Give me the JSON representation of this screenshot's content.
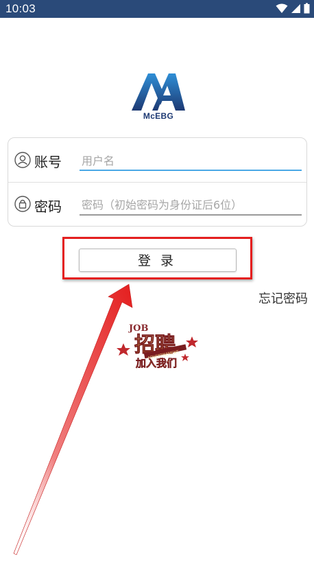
{
  "status_bar": {
    "time": "10:03",
    "background": "#2a4a79",
    "icons": [
      "wifi-icon",
      "cellular-signal-icon",
      "battery-icon"
    ]
  },
  "logo": {
    "text": "McEBG",
    "primary_color": "#1d3973",
    "accent_color": "#2f8fd6"
  },
  "login_form": {
    "account": {
      "icon": "user-icon",
      "label": "账号",
      "placeholder": "用户名",
      "value": "",
      "underline_color": "#4aa8e6"
    },
    "password": {
      "icon": "lock-icon",
      "label": "密码",
      "placeholder": "密码（初始密码为身份证后6位）",
      "value": "",
      "underline_color": "#9a9a9a"
    }
  },
  "login_button": {
    "label": "登录"
  },
  "forgot_password": {
    "label": "忘记密码"
  },
  "recruit_banner": {
    "icon": "recruitment-banner-image",
    "caption": "招聘 JOB ADVERTISEMENT 加入我们"
  },
  "annotation": {
    "highlight_color": "#e41e1e"
  }
}
